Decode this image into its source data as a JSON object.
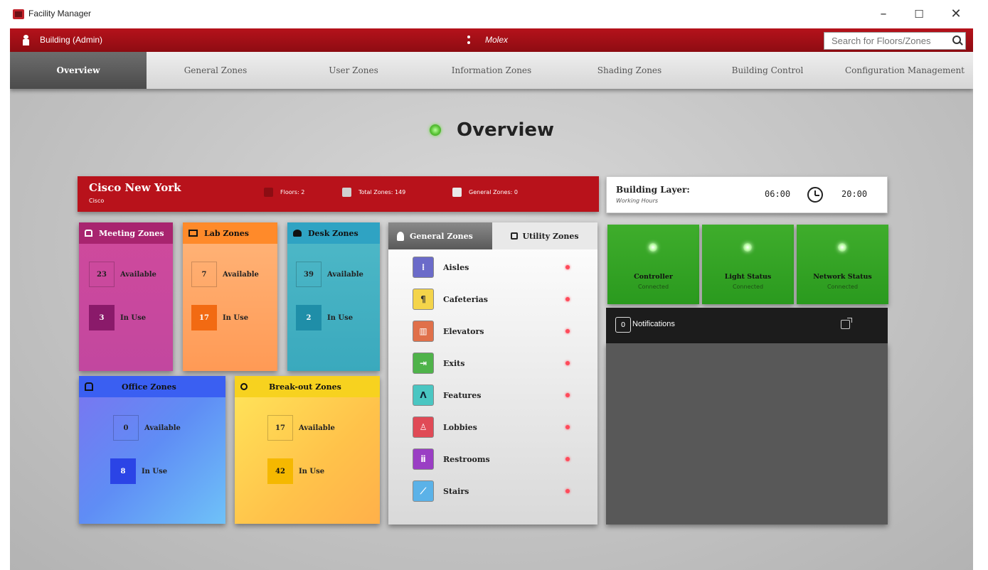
{
  "window": {
    "title": "Facility Manager",
    "controls": {
      "minimize": "–",
      "maximize": "☐",
      "close": "✕"
    }
  },
  "topbar": {
    "building_label": "Building (Admin)",
    "user_label": "Molex",
    "search": {
      "placeholder": "Search for Floors/Zones"
    }
  },
  "tabs": [
    {
      "label": "Overview",
      "active": true
    },
    {
      "label": "General Zones"
    },
    {
      "label": "User Zones"
    },
    {
      "label": "Information Zones"
    },
    {
      "label": "Shading Zones"
    },
    {
      "label": "Building Control"
    },
    {
      "label": "Configuration Management"
    }
  ],
  "page": {
    "title": "Overview"
  },
  "building": {
    "name": "Cisco New York",
    "sub": "Cisco",
    "floors": "Floors: 2",
    "total_zones": "Total Zones: 149",
    "general_zones": "General Zones: 0"
  },
  "layer": {
    "title": "Building Layer:",
    "subtitle": "Working Hours",
    "start": "06:00",
    "end": "20:00"
  },
  "zones": {
    "meeting": {
      "title": "Meeting Zones",
      "available": "23",
      "in_use": "3",
      "available_label": "Available",
      "in_use_label": "In Use"
    },
    "lab": {
      "title": "Lab Zones",
      "available": "7",
      "in_use": "17",
      "available_label": "Available",
      "in_use_label": "In Use"
    },
    "desk": {
      "title": "Desk Zones",
      "available": "39",
      "in_use": "2",
      "available_label": "Available",
      "in_use_label": "In Use"
    },
    "office": {
      "title": "Office Zones",
      "available": "0",
      "in_use": "8",
      "available_label": "Available",
      "in_use_label": "In Use"
    },
    "breakout": {
      "title": "Break-out Zones",
      "available": "17",
      "in_use": "42",
      "available_label": "Available",
      "in_use_label": "In Use"
    }
  },
  "general_panel": {
    "tab_general": "General Zones",
    "tab_utility": "Utility Zones",
    "items": [
      {
        "label": "Aisles",
        "color": "#6b6bc9"
      },
      {
        "label": "Cafeterias",
        "color": "#f4d44a"
      },
      {
        "label": "Elevators",
        "color": "#e0704a"
      },
      {
        "label": "Exits",
        "color": "#4fb34a"
      },
      {
        "label": "Features",
        "color": "#4ac6c2"
      },
      {
        "label": "Lobbies",
        "color": "#e04a56"
      },
      {
        "label": "Restrooms",
        "color": "#9a3ec4"
      },
      {
        "label": "Stairs",
        "color": "#5bb2e8"
      }
    ]
  },
  "status": {
    "controller": {
      "label": "Controller",
      "state": "Connected"
    },
    "light": {
      "label": "Light Status",
      "state": "Connected"
    },
    "network": {
      "label": "Network Status",
      "state": "Connected"
    }
  },
  "notifications": {
    "count": "0",
    "label": "Notifications"
  }
}
